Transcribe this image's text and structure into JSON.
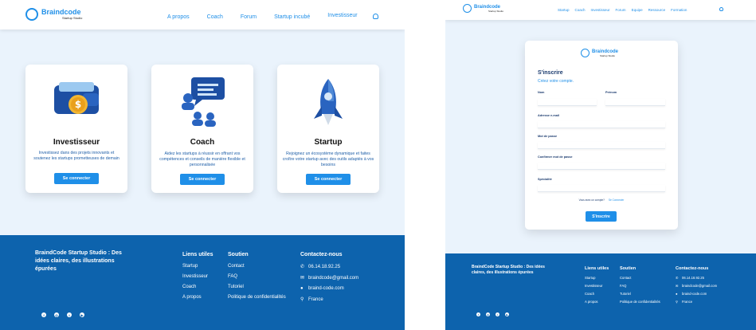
{
  "left": {
    "logo": {
      "title": "Braindcode",
      "subtitle": "Startup Studio"
    },
    "nav": [
      "A propos",
      "Coach",
      "Forum",
      "Startup incubé",
      "Investisseur"
    ],
    "cards": [
      {
        "title": "Investisseur",
        "description": "Investissez dans des projets innovants et soutenez les startups prometteuses de demain",
        "button": "Se connecter"
      },
      {
        "title": "Coach",
        "description": "Aidez les startups à réussir en offrant vos compétences et conseils de manière flexible et personnalisée",
        "button": "Se connecter"
      },
      {
        "title": "Startup",
        "description": "Rejoignez un écosystème dynamique et faites croître votre startup avec des outils adaptés à vos besoins",
        "button": "Se connecter"
      }
    ],
    "footer": {
      "tagline": "BraindCode Startup Studio : Des idées claires, des illustrations épurées",
      "useful_links": {
        "heading": "Liens utiles",
        "items": [
          "Startup",
          "Investisseur",
          "Coach",
          "A propos"
        ]
      },
      "support": {
        "heading": "Soutien",
        "items": [
          "Contact",
          "FAQ",
          "Tutoriel",
          "Politique de confidentialités"
        ]
      },
      "contact": {
        "heading": "Contactez-nous",
        "items": [
          "06.14.18.92.25",
          "braindcode@gmail.com",
          "braind-code.com",
          "France"
        ]
      }
    }
  },
  "right": {
    "logo": {
      "title": "Braindcode",
      "subtitle": "Startup Studio"
    },
    "nav": [
      "Startup",
      "Coach",
      "Investisseur",
      "Forum",
      "Equipe",
      "Ressource",
      "Formation"
    ],
    "form": {
      "logo_title": "Braindcode",
      "logo_subtitle": "Startup Studio",
      "title": "S'inscrire",
      "subtitle": "Créez votre compte.",
      "fields": {
        "nom": "Nom",
        "prenom": "Prénom",
        "email": "Adresse e-mail",
        "password": "Mot de passe",
        "confirm": "Confirmer mot de passe",
        "specialite": "Spécialité"
      },
      "login_prompt": "Vous avez un compte?",
      "login_link": "Se Connecter",
      "submit": "S'inscrire"
    },
    "footer": {
      "tagline": "BraindCode Startup Studio : Des idées claires, des illustrations épurées",
      "useful_links": {
        "heading": "Liens utiles",
        "items": [
          "Startup",
          "Investisseur",
          "Coach",
          "A propos"
        ]
      },
      "support": {
        "heading": "Soutien",
        "items": [
          "Contact",
          "FAQ",
          "Tutoriel",
          "Politique de confidentialités"
        ]
      },
      "contact": {
        "heading": "Contactez-nous",
        "items": [
          "06.14.18.92.25",
          "braindcode@gmail.com",
          "braind-code.com",
          "France"
        ]
      }
    }
  },
  "colors": {
    "primary": "#1f8fe8",
    "footer": "#0d63ad",
    "background": "#eaf3fc"
  }
}
